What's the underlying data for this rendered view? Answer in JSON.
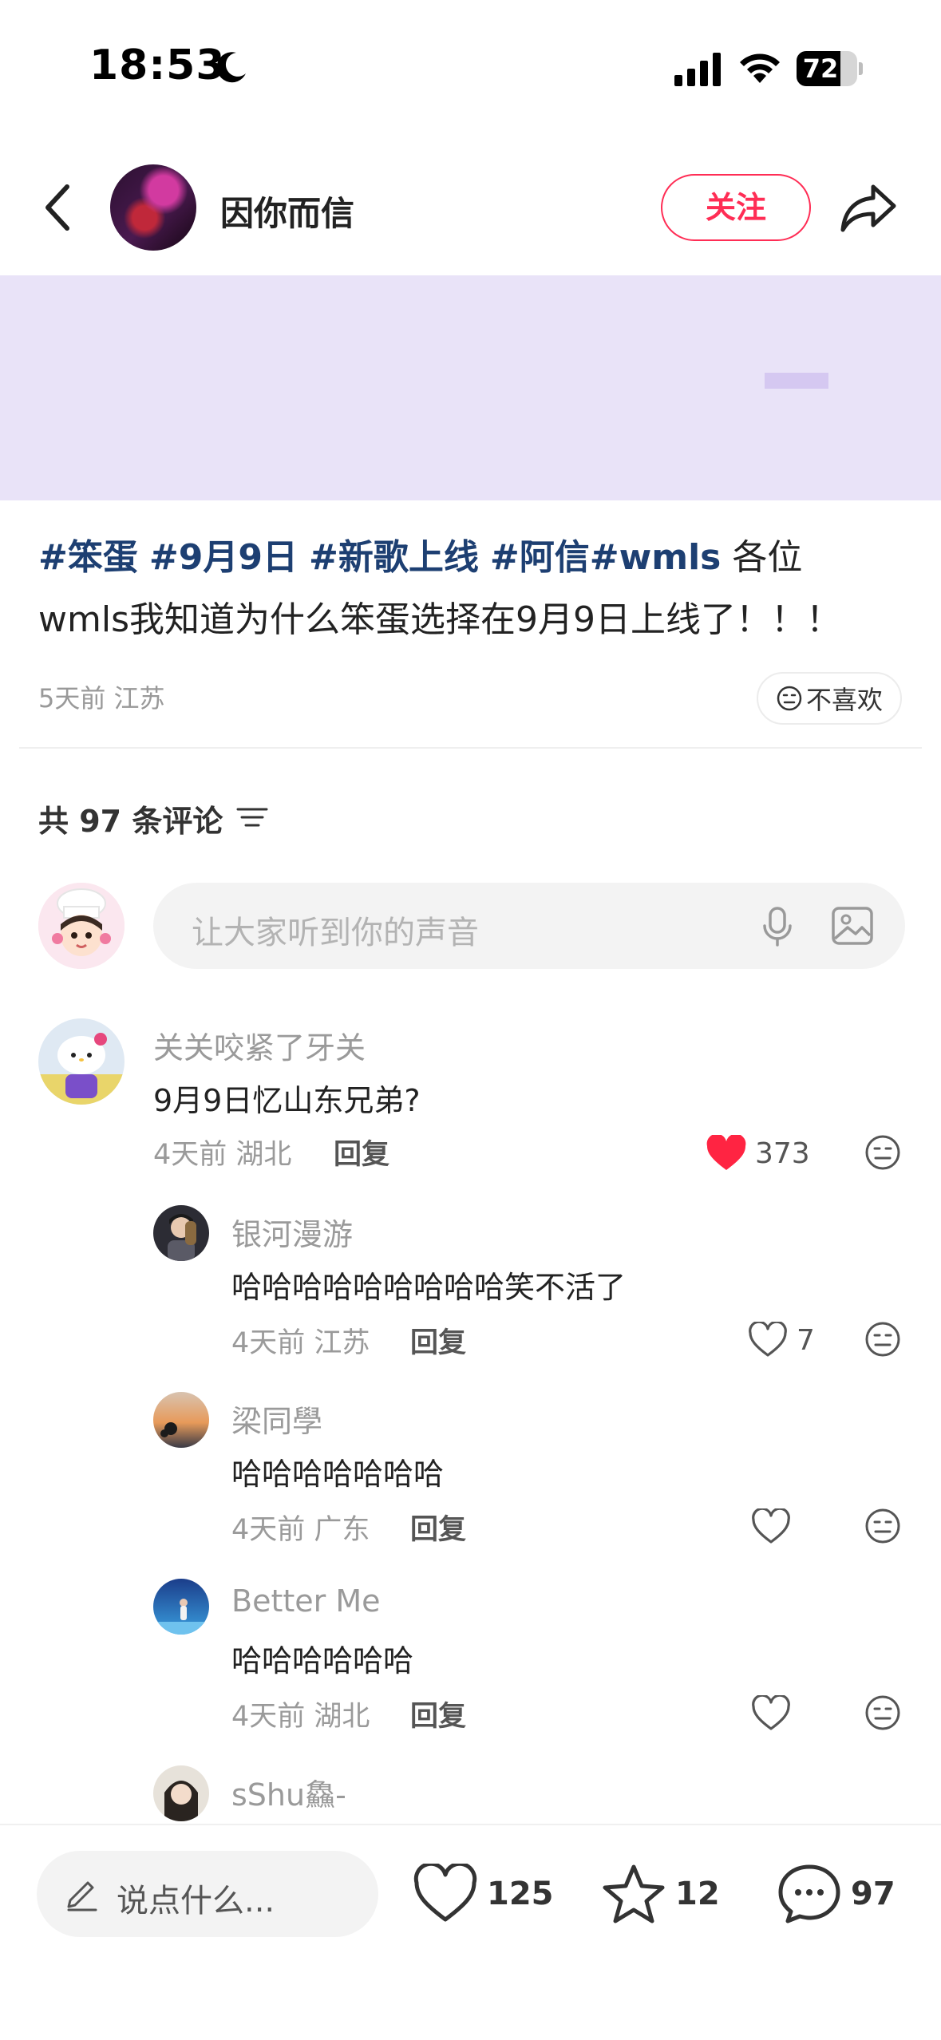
{
  "status_bar": {
    "time": "18:53",
    "battery_level": "72",
    "battery_fraction": 0.72
  },
  "header": {
    "author_name": "因你而信",
    "follow_label": "关注"
  },
  "post": {
    "tags": [
      "#笨蛋",
      "#9月9日",
      "#新歌上线",
      "#阿信",
      "#wmls"
    ],
    "text_line1_rest": "各位",
    "text_line2": "wmls我知道为什么笨蛋选择在9月9日上线了！！！",
    "meta": "5天前 江苏",
    "dislike_label": "不喜欢"
  },
  "comments_header": {
    "label": "共 97 条评论"
  },
  "comment_input": {
    "placeholder": "让大家听到你的声音"
  },
  "comments": [
    {
      "name": "关关咬紧了牙关",
      "text": "9月9日忆山东兄弟?",
      "meta": "4天前 湖北",
      "reply": "回复",
      "likes": "373",
      "liked": true
    },
    {
      "name": "银河漫游",
      "text": "哈哈哈哈哈哈哈哈哈笑不活了",
      "meta": "4天前 江苏",
      "reply": "回复",
      "likes": "7",
      "liked": false
    },
    {
      "name": "梁同學",
      "text": "哈哈哈哈哈哈哈",
      "meta": "4天前 广东",
      "reply": "回复",
      "likes": "",
      "liked": false
    },
    {
      "name": "Better Me",
      "text": "哈哈哈哈哈哈",
      "meta": "4天前 湖北",
      "reply": "回复",
      "likes": "",
      "liked": false
    },
    {
      "name": "sShu鱻-",
      "text": "",
      "meta": "",
      "reply": "",
      "likes": "",
      "liked": false
    }
  ],
  "bottom_bar": {
    "say_placeholder": "说点什么...",
    "likes": "125",
    "favorites": "12",
    "comments": "97"
  },
  "colors": {
    "accent": "#ff2d55",
    "tag": "#1d3f72",
    "image_bg": "#e9e3f8",
    "liked_heart": "#ff2442"
  },
  "icons": [
    "moon-icon",
    "signal-icon",
    "wifi-icon",
    "battery-icon",
    "back-icon",
    "share-icon",
    "dislike-face-icon",
    "sort-icon",
    "mic-icon",
    "image-icon",
    "heart-icon",
    "face-icon",
    "pencil-icon",
    "star-icon",
    "comment-icon"
  ]
}
